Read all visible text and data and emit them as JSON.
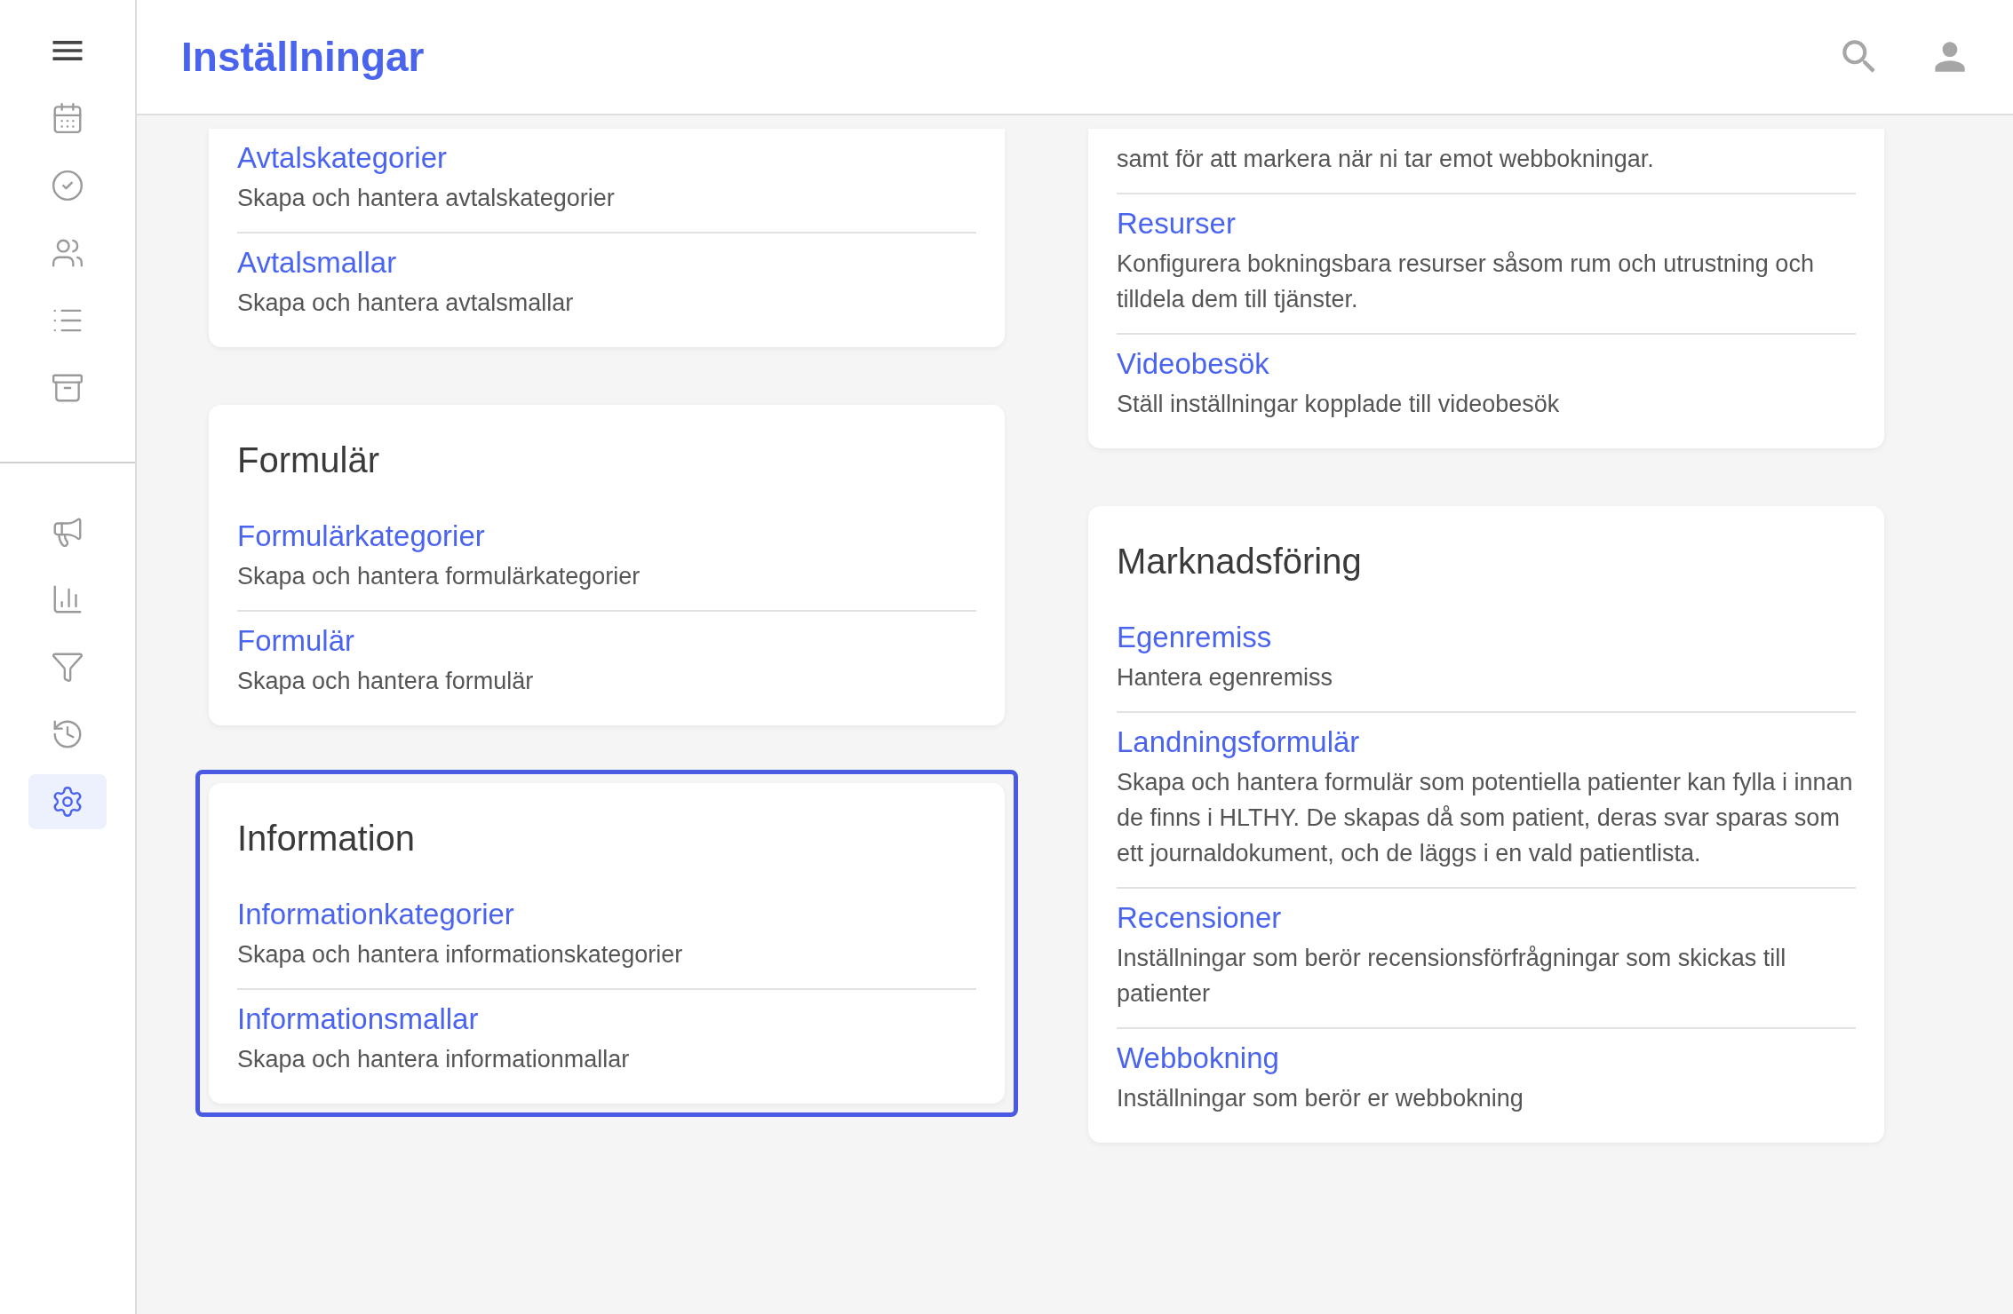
{
  "header": {
    "title": "Inställningar"
  },
  "sidebar": {
    "top_items": [
      {
        "kind": "menu",
        "selected": false
      },
      {
        "kind": "calendar",
        "selected": false
      },
      {
        "kind": "check",
        "selected": false
      },
      {
        "kind": "people",
        "selected": false
      },
      {
        "kind": "list",
        "selected": false
      },
      {
        "kind": "archive",
        "selected": false
      }
    ],
    "bottom_items": [
      {
        "kind": "megaphone",
        "selected": false
      },
      {
        "kind": "chart",
        "selected": false
      },
      {
        "kind": "filter",
        "selected": false
      },
      {
        "kind": "history",
        "selected": false
      },
      {
        "kind": "settings",
        "selected": true
      }
    ]
  },
  "columns": [
    {
      "sections": [
        {
          "highlighted": false,
          "items": [
            {
              "title": "Avtalskategorier",
              "description": "Skapa och hantera avtalskategorier"
            },
            {
              "title": "Avtalsmallar",
              "description": "Skapa och hantera avtalsmallar"
            }
          ]
        },
        {
          "heading": "Formulär",
          "highlighted": false,
          "items": [
            {
              "title": "Formulärkategorier",
              "description": "Skapa och hantera formulärkategorier"
            },
            {
              "title": "Formulär",
              "description": "Skapa och hantera formulär"
            }
          ]
        },
        {
          "heading": "Information",
          "highlighted": true,
          "items": [
            {
              "title": "Informationkategorier",
              "description": "Skapa och hantera informationskategorier"
            },
            {
              "title": "Informationsmallar",
              "description": "Skapa och hantera informationmallar"
            }
          ]
        }
      ]
    },
    {
      "sections": [
        {
          "highlighted": false,
          "items": [
            {
              "description": "samt för att markera när ni tar emot webbokningar."
            },
            {
              "title": "Resurser",
              "description": "Konfigurera bokningsbara resurser såsom rum och utrustning och tilldela dem till tjänster."
            },
            {
              "title": "Videobesök",
              "description": "Ställ inställningar kopplade till videobesök"
            }
          ]
        },
        {
          "heading": "Marknadsföring",
          "highlighted": false,
          "items": [
            {
              "title": "Egenremiss",
              "description": "Hantera egenremiss"
            },
            {
              "title": "Landningsformulär",
              "description": "Skapa och hantera formulär som potentiella patienter kan fylla i innan de finns i HLTHY. De skapas då som patient, deras svar sparas som ett journaldokument, och de läggs i en vald patientlista."
            },
            {
              "title": "Recensioner",
              "description": "Inställningar som berör recensionsförfrågningar som skickas till patienter"
            },
            {
              "title": "Webbokning",
              "description": "Inställningar som berör er webbokning"
            }
          ]
        }
      ]
    }
  ]
}
